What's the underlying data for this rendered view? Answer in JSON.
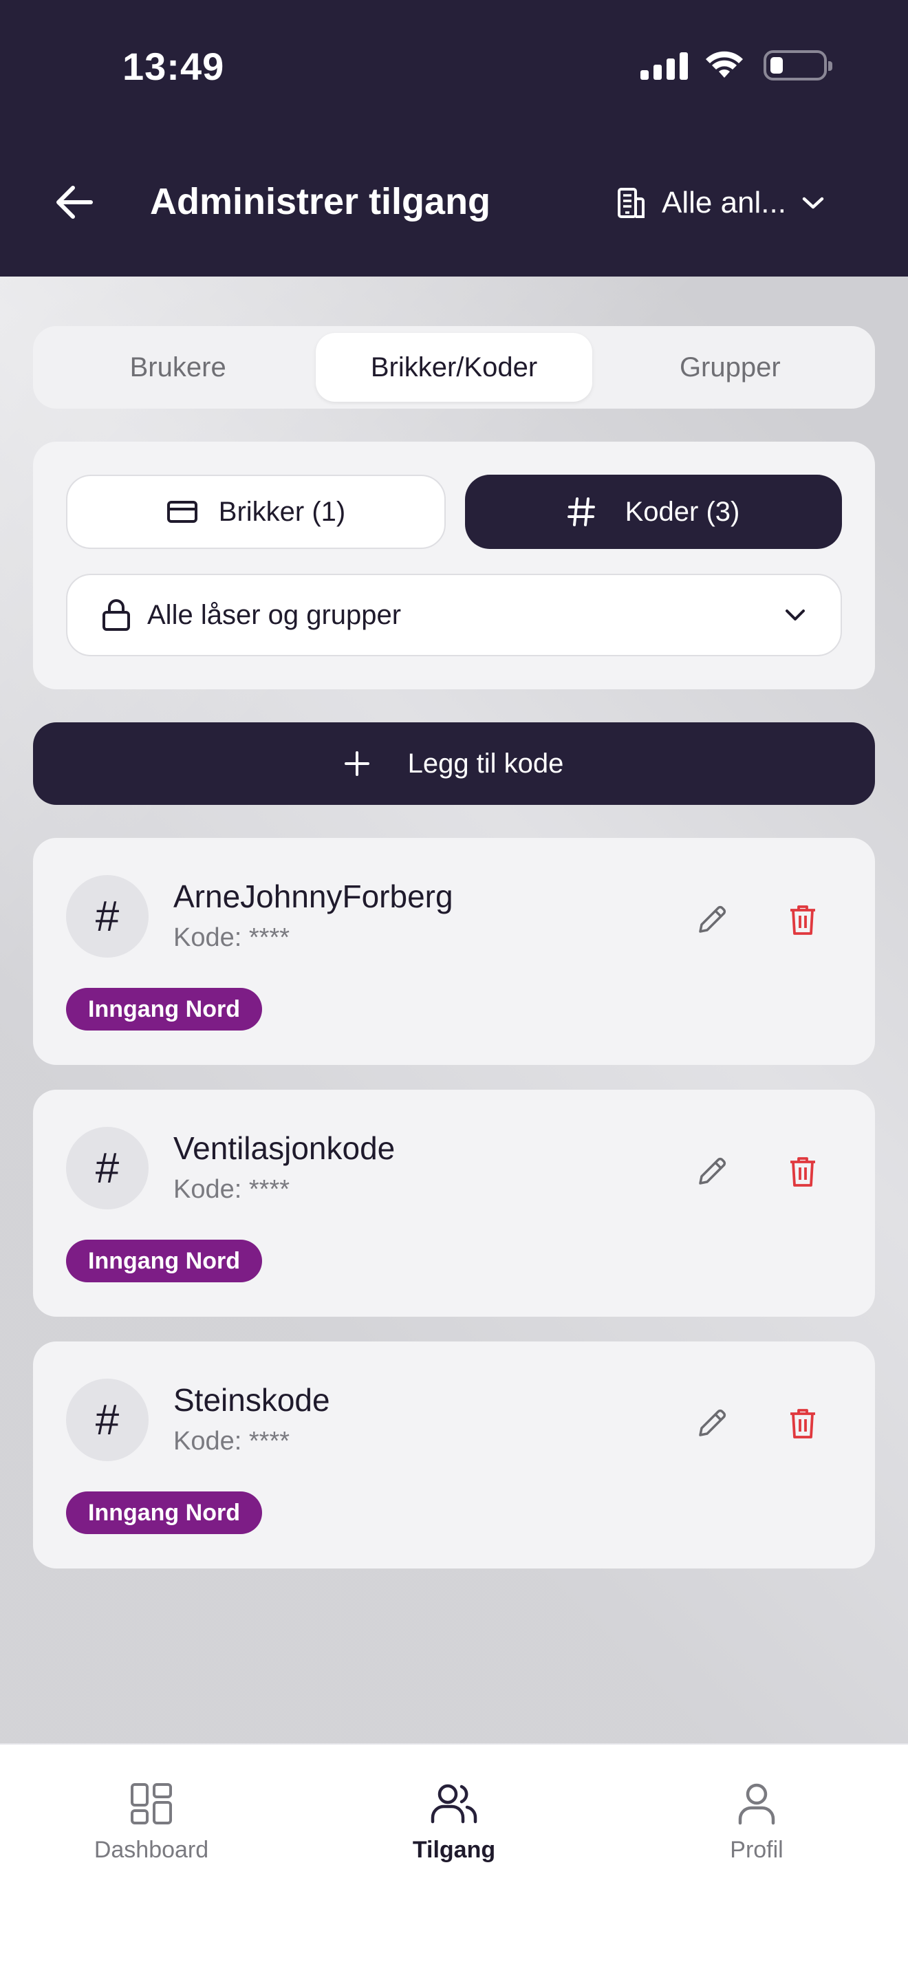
{
  "status_bar": {
    "time": "13:49"
  },
  "header": {
    "title": "Administrer tilgang",
    "site_selector": "Alle anl..."
  },
  "tabs": [
    {
      "label": "Brukere",
      "active": false
    },
    {
      "label": "Brikker/Koder",
      "active": true
    },
    {
      "label": "Grupper",
      "active": false
    }
  ],
  "filter": {
    "brikker_label": "Brikker (1)",
    "koder_label": "Koder (3)",
    "selected": "koder",
    "lock_filter": "Alle låser og grupper"
  },
  "add_button": {
    "label": "Legg til kode"
  },
  "codes": [
    {
      "name": "ArneJohnnyForberg",
      "code": "Kode: ****",
      "tag": "Inngang Nord"
    },
    {
      "name": "Ventilasjonkode",
      "code": "Kode: ****",
      "tag": "Inngang Nord"
    },
    {
      "name": "Steinskode",
      "code": "Kode: ****",
      "tag": "Inngang Nord"
    }
  ],
  "bottom_nav": [
    {
      "label": "Dashboard",
      "icon": "grid-icon",
      "active": false
    },
    {
      "label": "Tilgang",
      "icon": "users-icon",
      "active": true
    },
    {
      "label": "Profil",
      "icon": "person-icon",
      "active": false
    }
  ],
  "colors": {
    "header_bg": "#262039",
    "accent_dark": "#262039",
    "tag_purple": "#7d1d86",
    "delete_red": "#e0383e"
  }
}
